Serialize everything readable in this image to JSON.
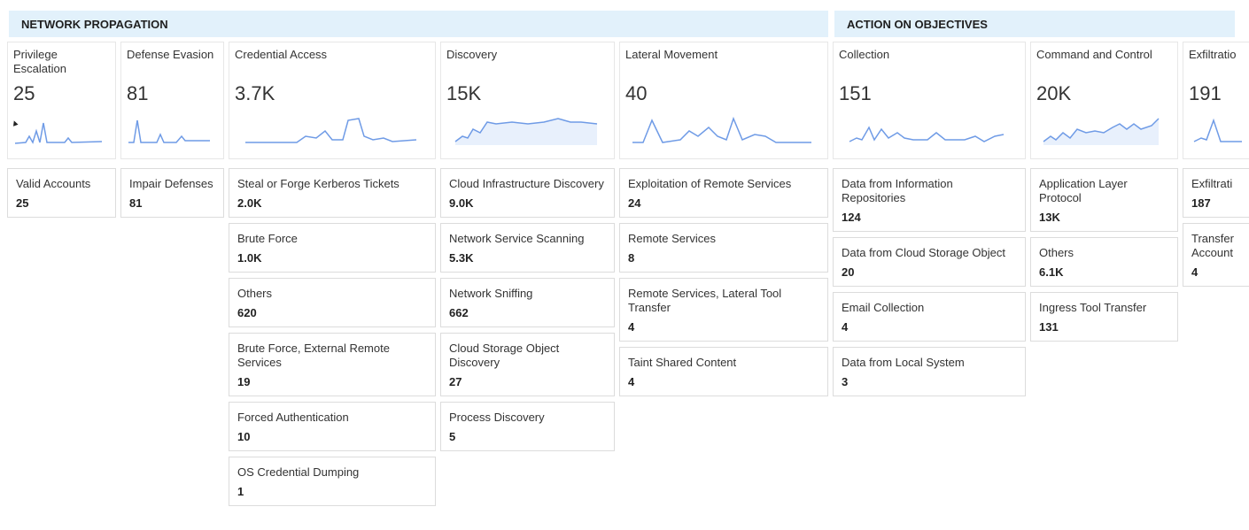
{
  "phases": [
    {
      "label": "NETWORK PROPAGATION"
    },
    {
      "label": "ACTION ON OBJECTIVES"
    }
  ],
  "columns": [
    {
      "name": "Privilege Escalation",
      "count": "25",
      "techniques": [
        {
          "name": "Valid Accounts",
          "count": "25"
        }
      ]
    },
    {
      "name": "Defense Evasion",
      "count": "81",
      "techniques": [
        {
          "name": "Impair Defenses",
          "count": "81"
        }
      ]
    },
    {
      "name": "Credential Access",
      "count": "3.7K",
      "techniques": [
        {
          "name": "Steal or Forge Kerberos Tickets",
          "count": "2.0K"
        },
        {
          "name": "Brute Force",
          "count": "1.0K"
        },
        {
          "name": "Others",
          "count": "620"
        },
        {
          "name": "Brute Force, External Remote Services",
          "count": "19"
        },
        {
          "name": "Forced Authentication",
          "count": "10"
        },
        {
          "name": "OS Credential Dumping",
          "count": "1"
        }
      ]
    },
    {
      "name": "Discovery",
      "count": "15K",
      "techniques": [
        {
          "name": "Cloud Infrastructure Discovery",
          "count": "9.0K"
        },
        {
          "name": "Network Service Scanning",
          "count": "5.3K"
        },
        {
          "name": "Network Sniffing",
          "count": "662"
        },
        {
          "name": "Cloud Storage Object Discovery",
          "count": "27"
        },
        {
          "name": "Process Discovery",
          "count": "5"
        }
      ]
    },
    {
      "name": "Lateral Movement",
      "count": "40",
      "techniques": [
        {
          "name": "Exploitation of Remote Services",
          "count": "24"
        },
        {
          "name": "Remote Services",
          "count": "8"
        },
        {
          "name": "Remote Services, Lateral Tool Transfer",
          "count": "4"
        },
        {
          "name": "Taint Shared Content",
          "count": "4"
        }
      ]
    },
    {
      "name": "Collection",
      "count": "151",
      "techniques": [
        {
          "name": "Data from Information Repositories",
          "count": "124"
        },
        {
          "name": "Data from Cloud Storage Object",
          "count": "20"
        },
        {
          "name": "Email Collection",
          "count": "4"
        },
        {
          "name": "Data from Local System",
          "count": "3"
        }
      ]
    },
    {
      "name": "Command and Control",
      "count": "20K",
      "techniques": [
        {
          "name": "Application Layer Protocol",
          "count": "13K"
        },
        {
          "name": "Others",
          "count": "6.1K"
        },
        {
          "name": "Ingress Tool Transfer",
          "count": "131"
        }
      ]
    },
    {
      "name": "Exfiltratio",
      "count": "191",
      "techniques": [
        {
          "name": "Exfiltrati",
          "count": "187"
        },
        {
          "name": "Transfer Account",
          "count": "4"
        }
      ]
    }
  ],
  "colors": {
    "sparkline": "#6f9be6",
    "band": "#e2f1fb"
  },
  "icons": {
    "cursor": "mouse-pointer-icon"
  }
}
